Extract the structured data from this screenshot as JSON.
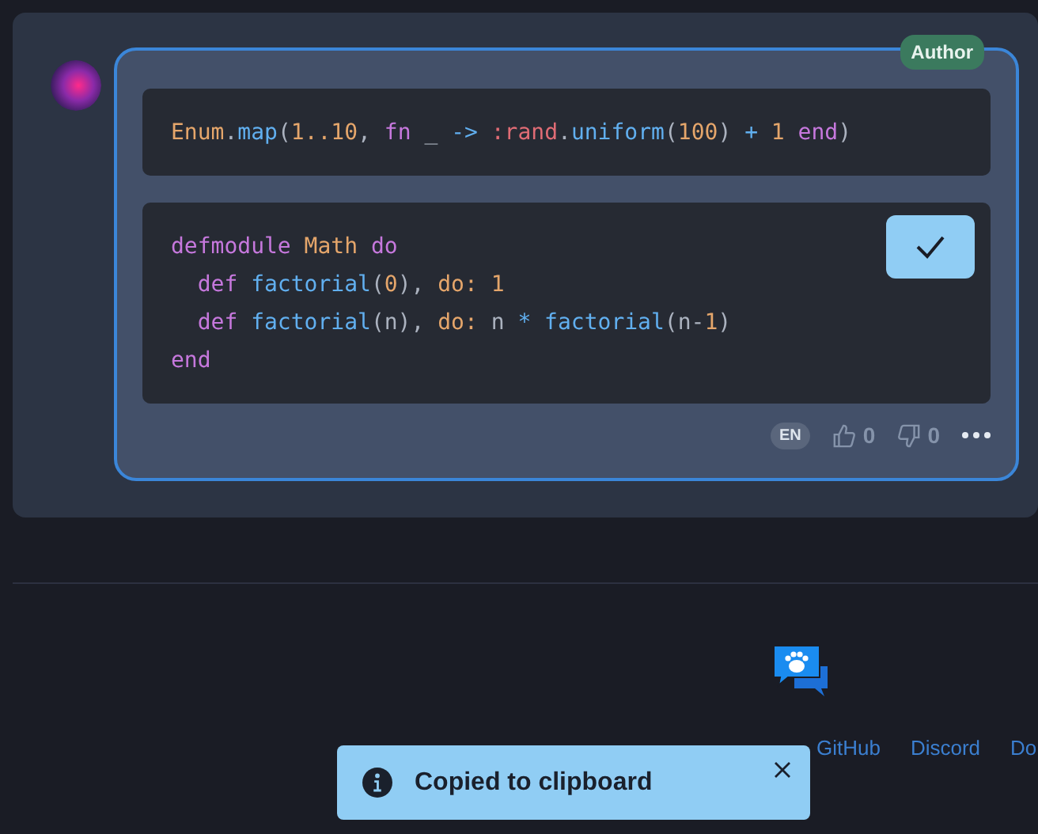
{
  "message": {
    "badge": "Author",
    "code_blocks": [
      {
        "lines": [
          [
            {
              "kind": "module",
              "text": "Enum"
            },
            {
              "kind": "punct",
              "text": "."
            },
            {
              "kind": "func",
              "text": "map"
            },
            {
              "kind": "punct",
              "text": "("
            },
            {
              "kind": "number",
              "text": "1..10"
            },
            {
              "kind": "punct",
              "text": ", "
            },
            {
              "kind": "keyword",
              "text": "fn"
            },
            {
              "kind": "punct",
              "text": " _ "
            },
            {
              "kind": "operator",
              "text": "-> "
            },
            {
              "kind": "atom",
              "text": ":rand"
            },
            {
              "kind": "punct",
              "text": "."
            },
            {
              "kind": "func",
              "text": "uniform"
            },
            {
              "kind": "punct",
              "text": "("
            },
            {
              "kind": "number",
              "text": "100"
            },
            {
              "kind": "punct",
              "text": ") "
            },
            {
              "kind": "operator",
              "text": "+ "
            },
            {
              "kind": "number",
              "text": "1 "
            },
            {
              "kind": "keyword",
              "text": "end"
            },
            {
              "kind": "punct",
              "text": ")"
            }
          ]
        ]
      },
      {
        "copy_button": {
          "copied": true
        },
        "lines": [
          [
            {
              "kind": "keyword",
              "text": "defmodule "
            },
            {
              "kind": "module",
              "text": "Math "
            },
            {
              "kind": "keyword",
              "text": "do"
            }
          ],
          [
            {
              "kind": "keyword",
              "text": "  def "
            },
            {
              "kind": "func",
              "text": "factorial"
            },
            {
              "kind": "punct",
              "text": "("
            },
            {
              "kind": "number",
              "text": "0"
            },
            {
              "kind": "punct",
              "text": "), "
            },
            {
              "kind": "number",
              "text": "do: 1"
            }
          ],
          [
            {
              "kind": "keyword",
              "text": "  def "
            },
            {
              "kind": "func",
              "text": "factorial"
            },
            {
              "kind": "punct",
              "text": "(n), "
            },
            {
              "kind": "number",
              "text": "do:"
            },
            {
              "kind": "punct",
              "text": " n "
            },
            {
              "kind": "operator",
              "text": "* "
            },
            {
              "kind": "func",
              "text": "factorial"
            },
            {
              "kind": "punct",
              "text": "(n-"
            },
            {
              "kind": "number",
              "text": "1"
            },
            {
              "kind": "punct",
              "text": ")"
            }
          ],
          [
            {
              "kind": "keyword",
              "text": "end"
            }
          ]
        ]
      }
    ],
    "language": "EN",
    "likes": "0",
    "dislikes": "0"
  },
  "footer": {
    "links": [
      "GitHub",
      "Discord",
      "Do"
    ]
  },
  "toast": {
    "text": "Copied to clipboard"
  }
}
